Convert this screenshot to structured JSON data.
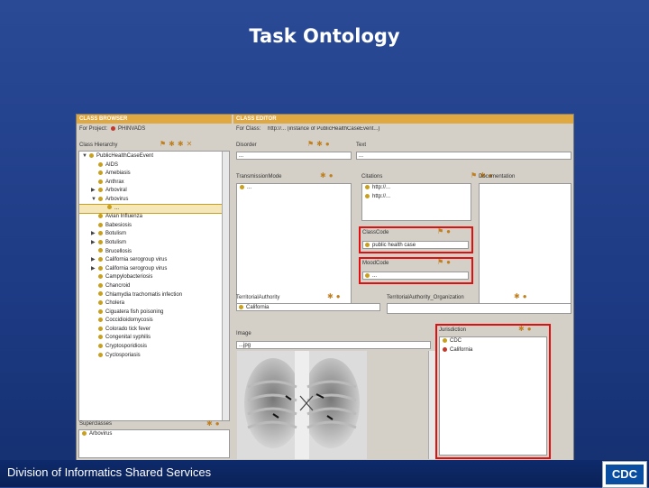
{
  "slide": {
    "title": "Task Ontology",
    "footer": "Division of Informatics Shared Services",
    "logo": "CDC"
  },
  "colors": {
    "accent": "#e0a840",
    "highlight": "#e01010",
    "background": "#1d3a84"
  },
  "browser": {
    "header": "CLASS BROWSER",
    "for_project_label": "For Project:",
    "project": "PHINVADS",
    "hierarchy_label": "Class Hierarchy",
    "tree": [
      {
        "label": "PublicHealthCaseEvent",
        "indent": 0,
        "arrow": "▼"
      },
      {
        "label": "AIDS",
        "indent": 1,
        "arrow": ""
      },
      {
        "label": "Amebiasis",
        "indent": 1,
        "arrow": ""
      },
      {
        "label": "Anthrax",
        "indent": 1,
        "arrow": ""
      },
      {
        "label": "Arboviral",
        "indent": 1,
        "arrow": "▶"
      },
      {
        "label": "Arbovirus",
        "indent": 1,
        "arrow": "▼"
      },
      {
        "label": "...",
        "indent": 2,
        "arrow": "",
        "selected": true
      },
      {
        "label": "Avian Influenza",
        "indent": 1,
        "arrow": ""
      },
      {
        "label": "Babesiosis",
        "indent": 1,
        "arrow": ""
      },
      {
        "label": "Botulism",
        "indent": 1,
        "arrow": "▶"
      },
      {
        "label": "Botulism",
        "indent": 1,
        "arrow": "▶"
      },
      {
        "label": "Brucellosis",
        "indent": 1,
        "arrow": ""
      },
      {
        "label": "California serogroup virus",
        "indent": 1,
        "arrow": "▶"
      },
      {
        "label": "California serogroup virus",
        "indent": 1,
        "arrow": "▶"
      },
      {
        "label": "Campylobacteriosis",
        "indent": 1,
        "arrow": ""
      },
      {
        "label": "Chancroid",
        "indent": 1,
        "arrow": ""
      },
      {
        "label": "Chlamydia trachomatis infection",
        "indent": 1,
        "arrow": ""
      },
      {
        "label": "Cholera",
        "indent": 1,
        "arrow": ""
      },
      {
        "label": "Ciguatera fish poisoning",
        "indent": 1,
        "arrow": ""
      },
      {
        "label": "Coccidioidomycosis",
        "indent": 1,
        "arrow": ""
      },
      {
        "label": "Colorado tick fever",
        "indent": 1,
        "arrow": ""
      },
      {
        "label": "Congenital syphilis",
        "indent": 1,
        "arrow": ""
      },
      {
        "label": "Cryptosporidiosis",
        "indent": 1,
        "arrow": ""
      },
      {
        "label": "Cyclosporiasis",
        "indent": 1,
        "arrow": ""
      }
    ],
    "superclasses_label": "Superclasses",
    "superclass": "Arbovirus"
  },
  "editor": {
    "header": "CLASS EDITOR",
    "for_class_label": "For Class:",
    "class_path": "http://... (instance of PublicHealthCaseEvent...)",
    "disorder_label": "Disorder",
    "disorder_value": "...",
    "text_label": "Text",
    "text_value": "...",
    "transmission_label": "TransmissionMode",
    "transmission_value": "...",
    "citations_label": "Citations",
    "citations": [
      "http://...",
      "http://..."
    ],
    "documentation_label": "Documentation",
    "classcode_label": "ClassCode",
    "classcode_value": "public health case",
    "moodcode_label": "MoodCode",
    "moodcode_value": "...",
    "territorial_label": "TerritorialAuthority",
    "territorial_value": "California",
    "territorial2_label": "TerritorialAuthority_Organization",
    "image_label": "Image",
    "image_value": "...jpg",
    "jurisdiction_label": "Jurisdiction",
    "jurisdiction_items": [
      "CDC",
      "California"
    ]
  }
}
